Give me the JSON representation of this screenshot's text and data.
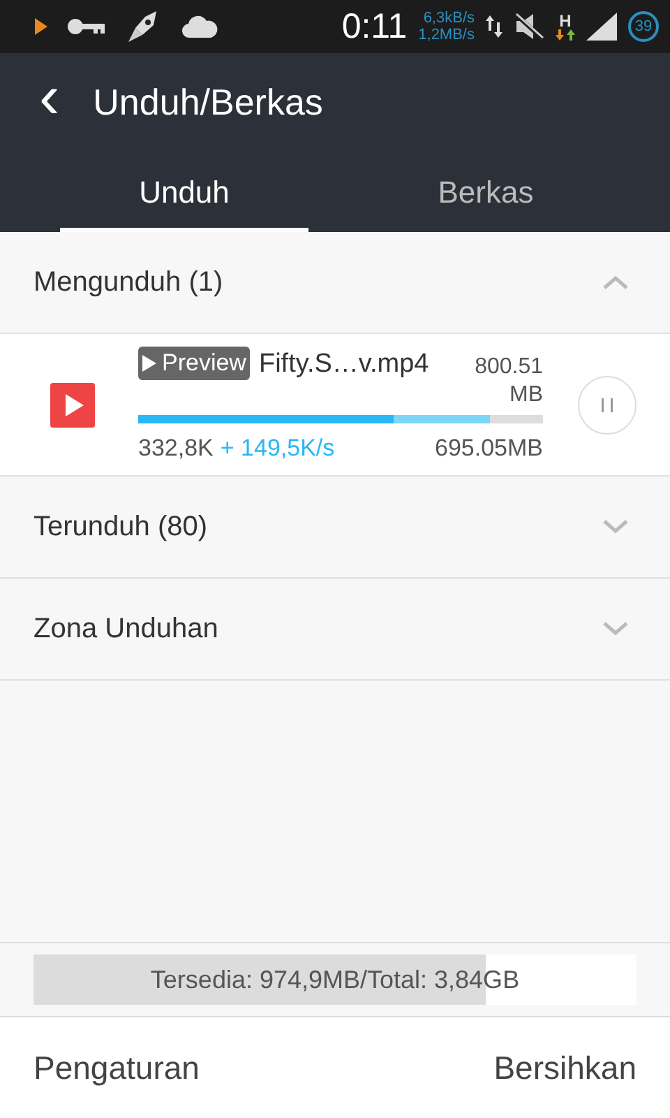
{
  "status_bar": {
    "time": "0:11",
    "speed_up": "6,3kB/s",
    "speed_down": "1,2MB/s",
    "network": "H",
    "battery": "39"
  },
  "toolbar": {
    "back": "‹",
    "title": "Unduh/Berkas"
  },
  "tabs": [
    {
      "label": "Unduh",
      "selected": true
    },
    {
      "label": "Berkas",
      "selected": false
    }
  ],
  "sections": [
    {
      "title": "Mengunduh (1)",
      "expanded": true,
      "items": [
        {
          "badge": "Preview",
          "name": "Fifty.S…v.mp4",
          "size": "800.51 MB",
          "level": 0.63,
          "buffer": {
            "level": 0.87
          },
          "downloaded": "332,8K",
          "speed": "+ 149,5K/s",
          "remaining": "695.05MB"
        }
      ]
    },
    {
      "title": "Terunduh (80)",
      "expanded": false
    },
    {
      "title": "Zona Unduhan",
      "expanded": false
    }
  ],
  "storage": {
    "text": "Tersedia: 974,9MB/Total: 3,84GB",
    "level": 0.75
  },
  "footer": {
    "left": "Pengaturan",
    "right": "Bersihkan"
  }
}
